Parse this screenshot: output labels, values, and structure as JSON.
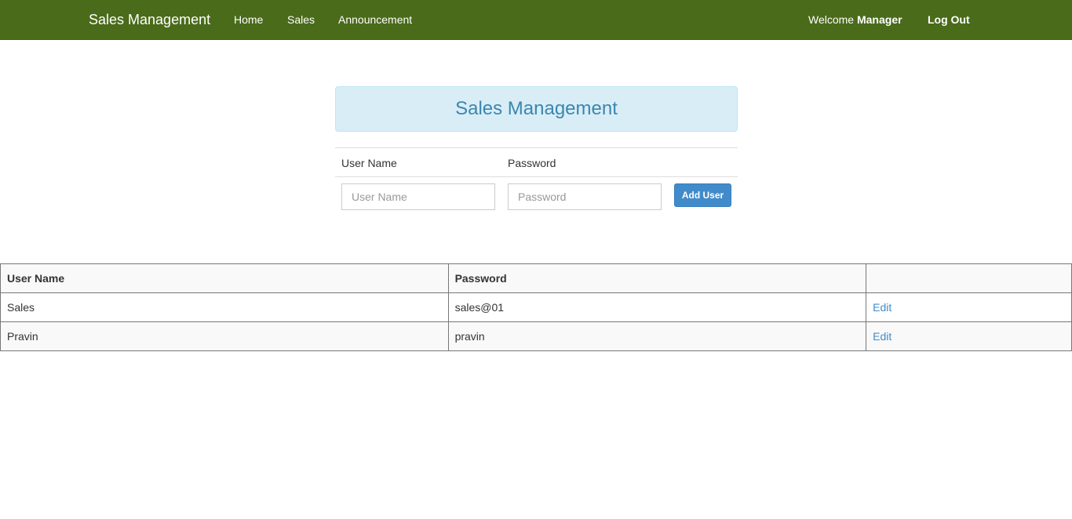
{
  "navbar": {
    "brand": "Sales Management",
    "links": [
      "Home",
      "Sales",
      "Announcement"
    ],
    "welcome_prefix": "Welcome",
    "welcome_user": "Manager",
    "logout": "Log Out",
    "bg_color": "#4a6b1a"
  },
  "panel": {
    "title": "Sales Management"
  },
  "form": {
    "username_label": "User Name",
    "password_label": "Password",
    "username_placeholder": "User Name",
    "password_placeholder": "Password",
    "add_button": "Add User"
  },
  "table": {
    "headers": [
      "User Name",
      "Password",
      ""
    ],
    "rows": [
      {
        "username": "Sales",
        "password": "sales@01",
        "action": "Edit"
      },
      {
        "username": "Pravin",
        "password": "pravin",
        "action": "Edit"
      }
    ]
  }
}
